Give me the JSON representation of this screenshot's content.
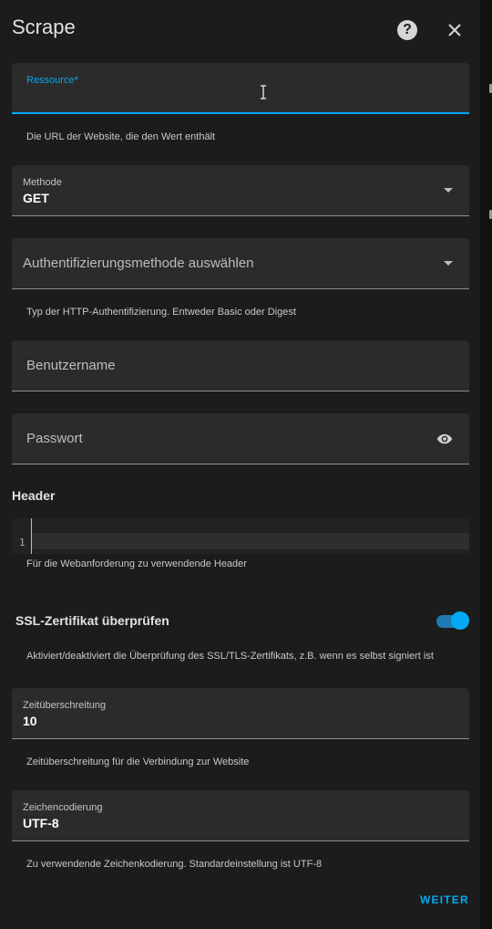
{
  "dialog": {
    "title": "Scrape"
  },
  "icons": {
    "help": "help-icon",
    "close": "close-icon",
    "eye": "eye-icon",
    "dropdown": "chevron-down-icon"
  },
  "colors": {
    "accent": "#03a9f4",
    "surface": "#2b2b2b",
    "background": "#1c1c1c"
  },
  "fields": {
    "resource": {
      "label": "Ressource*",
      "value": "",
      "helper": "Die URL der Website, die den Wert enthält"
    },
    "method": {
      "label": "Methode",
      "value": "GET"
    },
    "auth": {
      "placeholder": "Authentifizierungsmethode auswählen",
      "helper": "Typ der HTTP-Authentifizierung. Entweder Basic oder Digest"
    },
    "username": {
      "placeholder": "Benutzername"
    },
    "password": {
      "placeholder": "Passwort"
    },
    "headers": {
      "title": "Header",
      "line_number": "1",
      "helper": "Für die Webanforderung zu verwendende Header"
    },
    "ssl": {
      "label": "SSL-Zertifikat überprüfen",
      "enabled": true,
      "helper": "Aktiviert/deaktiviert die Überprüfung des SSL/TLS-Zertifikats, z.B. wenn es selbst signiert ist"
    },
    "timeout": {
      "label": "Zeitüberschreitung",
      "value": "10",
      "helper": "Zeitüberschreitung für die Verbindung zur Website"
    },
    "encoding": {
      "label": "Zeichencodierung",
      "value": "UTF-8",
      "helper": "Zu verwendende Zeichenkodierung. Standardeinstellung ist UTF-8"
    }
  },
  "actions": {
    "submit_label": "WEITER"
  }
}
